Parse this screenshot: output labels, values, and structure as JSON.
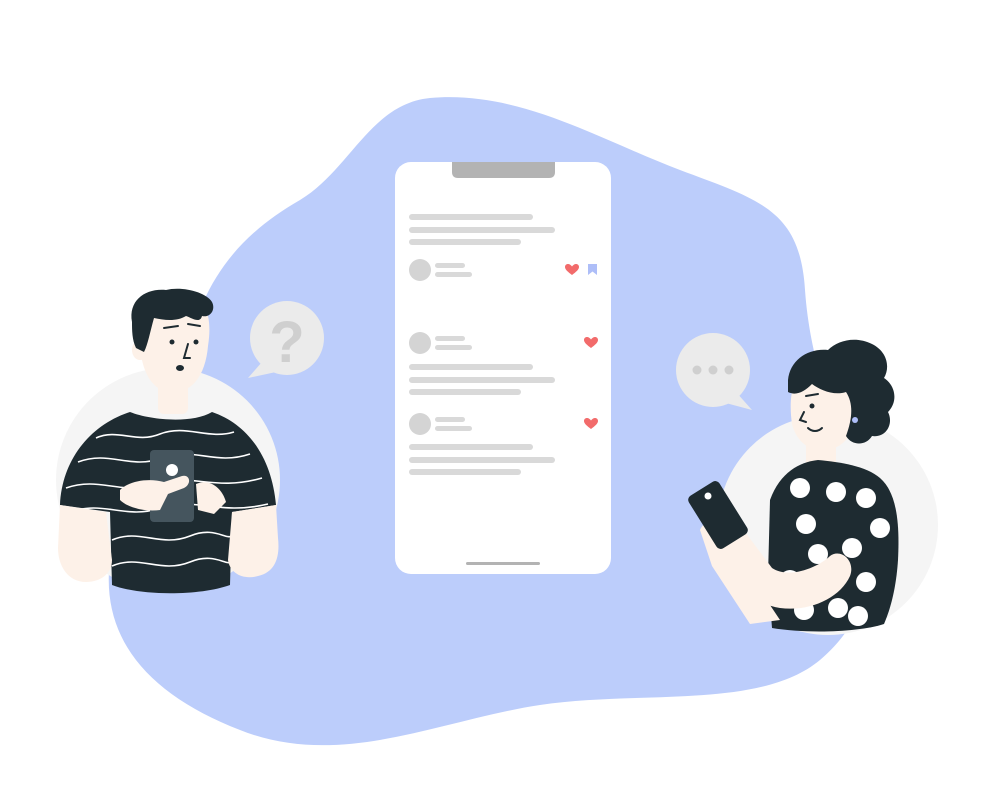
{
  "colors": {
    "background": "#ffffff",
    "blob": "#bccdfb",
    "phone_screen": "#ffffff",
    "skeleton": "#d9d9d9",
    "avatar_placeholder": "#d4d4d4",
    "notch": "#b3b3b3",
    "heart": "#f26b6b",
    "bookmark": "#aebef8",
    "bubble": "#ebebeb",
    "bubble_glyph": "#cfcfcf",
    "shirt": "#1e2b31",
    "hair": "#1e2b31",
    "skin": "#fdf1e8",
    "shirt_pattern": "#ffffff",
    "held_phone_left": "#45555e",
    "held_phone_right": "#1e2b31",
    "circle_bg": "#f5f5f5"
  },
  "feed_posts": [
    {
      "has_text_above": true,
      "has_heart": true,
      "has_bookmark": true
    },
    {
      "has_text_below": true,
      "has_heart": true,
      "has_bookmark": false
    },
    {
      "has_text_below": true,
      "has_heart": true,
      "has_bookmark": false
    }
  ],
  "icons": {
    "left_bubble": "question-mark-icon",
    "right_bubble": "ellipsis-icon",
    "post_like": "heart-icon",
    "post_save": "bookmark-icon"
  },
  "left_bubble_glyph": "?",
  "people": [
    {
      "role": "confused-man",
      "expression": "puzzled"
    },
    {
      "role": "smiling-woman",
      "expression": "smiling"
    }
  ]
}
